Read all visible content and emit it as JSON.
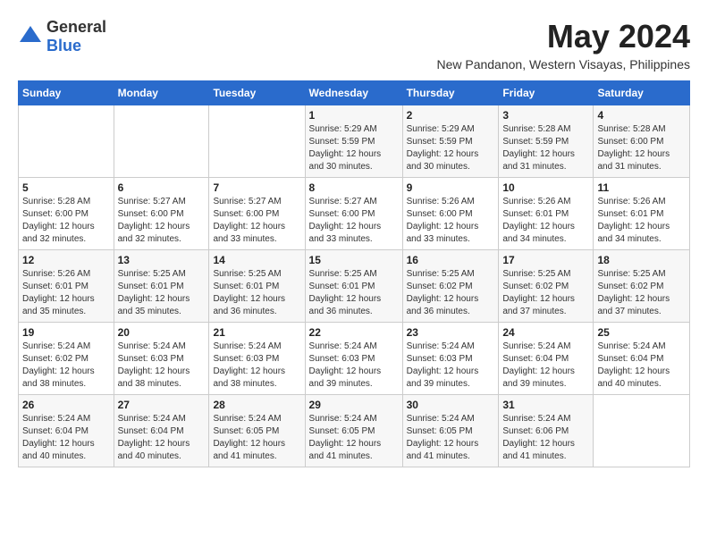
{
  "logo": {
    "text_general": "General",
    "text_blue": "Blue"
  },
  "title": {
    "month": "May 2024",
    "location": "New Pandanon, Western Visayas, Philippines"
  },
  "weekdays": [
    "Sunday",
    "Monday",
    "Tuesday",
    "Wednesday",
    "Thursday",
    "Friday",
    "Saturday"
  ],
  "weeks": [
    [
      {
        "day": "",
        "info": ""
      },
      {
        "day": "",
        "info": ""
      },
      {
        "day": "",
        "info": ""
      },
      {
        "day": "1",
        "info": "Sunrise: 5:29 AM\nSunset: 5:59 PM\nDaylight: 12 hours\nand 30 minutes."
      },
      {
        "day": "2",
        "info": "Sunrise: 5:29 AM\nSunset: 5:59 PM\nDaylight: 12 hours\nand 30 minutes."
      },
      {
        "day": "3",
        "info": "Sunrise: 5:28 AM\nSunset: 5:59 PM\nDaylight: 12 hours\nand 31 minutes."
      },
      {
        "day": "4",
        "info": "Sunrise: 5:28 AM\nSunset: 6:00 PM\nDaylight: 12 hours\nand 31 minutes."
      }
    ],
    [
      {
        "day": "5",
        "info": "Sunrise: 5:28 AM\nSunset: 6:00 PM\nDaylight: 12 hours\nand 32 minutes."
      },
      {
        "day": "6",
        "info": "Sunrise: 5:27 AM\nSunset: 6:00 PM\nDaylight: 12 hours\nand 32 minutes."
      },
      {
        "day": "7",
        "info": "Sunrise: 5:27 AM\nSunset: 6:00 PM\nDaylight: 12 hours\nand 33 minutes."
      },
      {
        "day": "8",
        "info": "Sunrise: 5:27 AM\nSunset: 6:00 PM\nDaylight: 12 hours\nand 33 minutes."
      },
      {
        "day": "9",
        "info": "Sunrise: 5:26 AM\nSunset: 6:00 PM\nDaylight: 12 hours\nand 33 minutes."
      },
      {
        "day": "10",
        "info": "Sunrise: 5:26 AM\nSunset: 6:01 PM\nDaylight: 12 hours\nand 34 minutes."
      },
      {
        "day": "11",
        "info": "Sunrise: 5:26 AM\nSunset: 6:01 PM\nDaylight: 12 hours\nand 34 minutes."
      }
    ],
    [
      {
        "day": "12",
        "info": "Sunrise: 5:26 AM\nSunset: 6:01 PM\nDaylight: 12 hours\nand 35 minutes."
      },
      {
        "day": "13",
        "info": "Sunrise: 5:25 AM\nSunset: 6:01 PM\nDaylight: 12 hours\nand 35 minutes."
      },
      {
        "day": "14",
        "info": "Sunrise: 5:25 AM\nSunset: 6:01 PM\nDaylight: 12 hours\nand 36 minutes."
      },
      {
        "day": "15",
        "info": "Sunrise: 5:25 AM\nSunset: 6:01 PM\nDaylight: 12 hours\nand 36 minutes."
      },
      {
        "day": "16",
        "info": "Sunrise: 5:25 AM\nSunset: 6:02 PM\nDaylight: 12 hours\nand 36 minutes."
      },
      {
        "day": "17",
        "info": "Sunrise: 5:25 AM\nSunset: 6:02 PM\nDaylight: 12 hours\nand 37 minutes."
      },
      {
        "day": "18",
        "info": "Sunrise: 5:25 AM\nSunset: 6:02 PM\nDaylight: 12 hours\nand 37 minutes."
      }
    ],
    [
      {
        "day": "19",
        "info": "Sunrise: 5:24 AM\nSunset: 6:02 PM\nDaylight: 12 hours\nand 38 minutes."
      },
      {
        "day": "20",
        "info": "Sunrise: 5:24 AM\nSunset: 6:03 PM\nDaylight: 12 hours\nand 38 minutes."
      },
      {
        "day": "21",
        "info": "Sunrise: 5:24 AM\nSunset: 6:03 PM\nDaylight: 12 hours\nand 38 minutes."
      },
      {
        "day": "22",
        "info": "Sunrise: 5:24 AM\nSunset: 6:03 PM\nDaylight: 12 hours\nand 39 minutes."
      },
      {
        "day": "23",
        "info": "Sunrise: 5:24 AM\nSunset: 6:03 PM\nDaylight: 12 hours\nand 39 minutes."
      },
      {
        "day": "24",
        "info": "Sunrise: 5:24 AM\nSunset: 6:04 PM\nDaylight: 12 hours\nand 39 minutes."
      },
      {
        "day": "25",
        "info": "Sunrise: 5:24 AM\nSunset: 6:04 PM\nDaylight: 12 hours\nand 40 minutes."
      }
    ],
    [
      {
        "day": "26",
        "info": "Sunrise: 5:24 AM\nSunset: 6:04 PM\nDaylight: 12 hours\nand 40 minutes."
      },
      {
        "day": "27",
        "info": "Sunrise: 5:24 AM\nSunset: 6:04 PM\nDaylight: 12 hours\nand 40 minutes."
      },
      {
        "day": "28",
        "info": "Sunrise: 5:24 AM\nSunset: 6:05 PM\nDaylight: 12 hours\nand 41 minutes."
      },
      {
        "day": "29",
        "info": "Sunrise: 5:24 AM\nSunset: 6:05 PM\nDaylight: 12 hours\nand 41 minutes."
      },
      {
        "day": "30",
        "info": "Sunrise: 5:24 AM\nSunset: 6:05 PM\nDaylight: 12 hours\nand 41 minutes."
      },
      {
        "day": "31",
        "info": "Sunrise: 5:24 AM\nSunset: 6:06 PM\nDaylight: 12 hours\nand 41 minutes."
      },
      {
        "day": "",
        "info": ""
      }
    ]
  ]
}
